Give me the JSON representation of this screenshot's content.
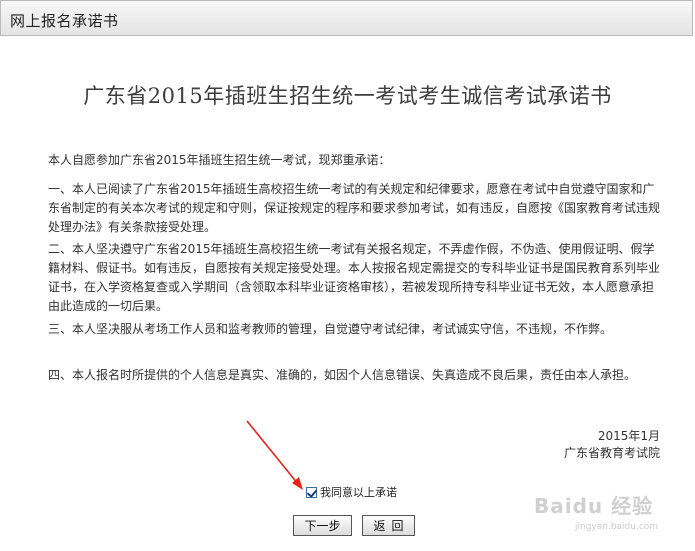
{
  "header": {
    "title": "网上报名承诺书"
  },
  "document": {
    "title": "广东省2015年插班生招生统一考试考生诚信考试承诺书",
    "paragraphs": [
      "本人自愿参加广东省2015年插班生招生统一考试，现郑重承诺：",
      "一、本人已阅读了广东省2015年插班生高校招生统一考试的有关规定和纪律要求，愿意在考试中自觉遵守国家和广东省制定的有关本次考试的规定和守则，保证按规定的程序和要求参加考试，如有违反，自愿按《国家教育考试违规处理办法》有关条款接受处理。",
      "二、本人坚决遵守广东省2015年插班生高校招生统一考试有关报名规定，不弄虚作假，不伪造、使用假证明、假学籍材料、假证书。如有违反，自愿按有关规定接受处理。本人按报名规定需提交的专科毕业证书是国民教育系列毕业证书，在入学资格复查或入学期间（含领取本科毕业证资格审核），若被发现所持专科毕业证书无效，本人愿意承担由此造成的一切后果。",
      "三、本人坚决服从考场工作人员和监考教师的管理，自觉遵守考试纪律，考试诚实守信，不违规，不作弊。",
      "四、本人报名时所提供的个人信息是真实、准确的，如因个人信息错误、失真造成不良后果，责任由本人承担。"
    ],
    "date": "2015年1月",
    "issuer": "广东省教育考试院"
  },
  "agreement": {
    "checked": true,
    "label": "我同意以上承诺"
  },
  "buttons": {
    "next_label": "下一步",
    "back_label": "返回"
  },
  "watermark": {
    "text": "Baidu 经验",
    "url": "jingyan.baidu.com"
  },
  "colors": {
    "arrow": "#e8201a",
    "header_bg": "#e8e8e8",
    "title_text": "#3d3d3d"
  }
}
